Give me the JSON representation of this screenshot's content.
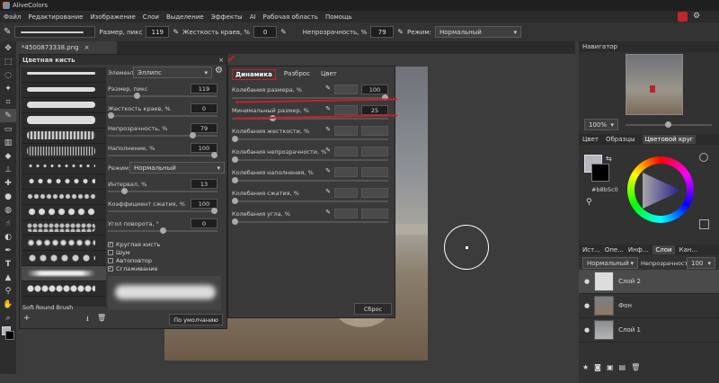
{
  "app": {
    "title": "AliveColors"
  },
  "menu": [
    "Файл",
    "Редактирование",
    "Изображение",
    "Слои",
    "Выделение",
    "Эффекты",
    "AI",
    "Рабочая область",
    "Помощь"
  ],
  "options": {
    "size_label": "Размер, пикс",
    "size_value": "119",
    "hardness_label": "Жесткость краев, %",
    "hardness_value": "0",
    "opacity_label": "Непрозрачность, %",
    "opacity_value": "79",
    "mode_label": "Режим:",
    "mode_value": "Нормальный"
  },
  "document": {
    "tab": "*4500873338.png"
  },
  "brush_panel": {
    "title": "Цветная кисть",
    "element_label": "Элемент:",
    "element_value": "Эллипс",
    "params": [
      {
        "label": "Размер, пикс",
        "value": "119",
        "frac": 0.25
      },
      {
        "label": "Жесткость краев, %",
        "value": "0",
        "frac": 0.0
      },
      {
        "label": "Непрозрачность, %",
        "value": "79",
        "frac": 0.79
      },
      {
        "label": "Наполнение, %",
        "value": "100",
        "frac": 1.0
      }
    ],
    "mode_label": "Режим:",
    "mode_value": "Нормальный",
    "params2": [
      {
        "label": "Интервал, %",
        "value": "13",
        "frac": 0.13
      },
      {
        "label": "Коэффициент сжатия, %",
        "value": "100",
        "frac": 1.0
      },
      {
        "label": "Угол поворота, °",
        "value": "0",
        "frac": 0.5
      }
    ],
    "checks": [
      {
        "label": "Круглая кисть",
        "checked": true
      },
      {
        "label": "Шум",
        "checked": false
      },
      {
        "label": "Автоповтор",
        "checked": false
      },
      {
        "label": "Сглаживание",
        "checked": true
      }
    ],
    "brush_name": "Soft Round Brush",
    "default_button": "По умолчанию"
  },
  "dynamics": {
    "tabs": [
      "Динамика",
      "Разброс",
      "Цвет"
    ],
    "rows": [
      {
        "label": "Колебания размера, %",
        "value": "100",
        "frac": 1.0
      },
      {
        "label": "Минимальный размер, %",
        "value": "25",
        "frac": 0.25
      },
      {
        "label": "Колебания жесткости, %",
        "value": "",
        "frac": 0.0
      },
      {
        "label": "Колебания непрозрачности, %",
        "value": "",
        "frac": 0.0
      },
      {
        "label": "Колебания наполнения, %",
        "value": "",
        "frac": 0.0
      },
      {
        "label": "Колебания сжатия, %",
        "value": "",
        "frac": 0.0
      },
      {
        "label": "Колебания угла, %",
        "value": "",
        "frac": 0.0
      }
    ],
    "reset_button": "Сброс"
  },
  "navigator": {
    "title": "Навигатор",
    "zoom": "100%"
  },
  "color": {
    "tabs": [
      "Цвет",
      "Образцы",
      "Цветовой круг"
    ],
    "hex": "#b8b5c0",
    "fg": "#b8b5c0",
    "bg": "#000000"
  },
  "layers": {
    "tabs": [
      "Ист...",
      "Опе...",
      "Инф...",
      "Слои",
      "Кан..."
    ],
    "mode": "Нормальный",
    "opacity_label": "Непрозрачность",
    "opacity_value": "100",
    "items": [
      {
        "name": "Слой 2"
      },
      {
        "name": "Фон"
      },
      {
        "name": "Слой 1"
      }
    ]
  }
}
